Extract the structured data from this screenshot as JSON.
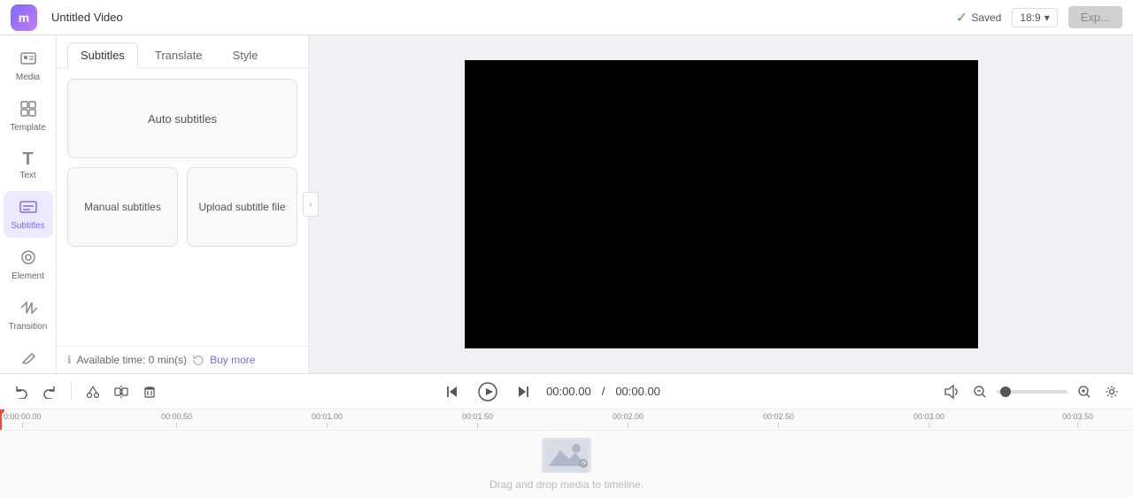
{
  "app": {
    "logo": "m",
    "title": "Untitled Video"
  },
  "topbar": {
    "saved_label": "Saved",
    "aspect_ratio": "18:9",
    "export_label": "Exp..."
  },
  "nav": {
    "items": [
      {
        "id": "media",
        "label": "Media",
        "icon": "⊞"
      },
      {
        "id": "template",
        "label": "Template",
        "icon": "⊡"
      },
      {
        "id": "text",
        "label": "Text",
        "icon": "T"
      },
      {
        "id": "subtitles",
        "label": "Subtitles",
        "icon": "▤",
        "active": true
      },
      {
        "id": "element",
        "label": "Element",
        "icon": "◎"
      },
      {
        "id": "transition",
        "label": "Transition",
        "icon": "⋙"
      }
    ]
  },
  "panel": {
    "tabs": [
      {
        "id": "subtitles",
        "label": "Subtitles",
        "active": true
      },
      {
        "id": "translate",
        "label": "Translate",
        "active": false
      },
      {
        "id": "style",
        "label": "Style",
        "active": false
      }
    ],
    "cards": {
      "auto": "Auto subtitles",
      "manual": "Manual subtitles",
      "upload": "Upload subtitle file"
    },
    "footer": {
      "icon": "ℹ",
      "text": "Available time: 0 min(s)",
      "link_label": "Buy more"
    }
  },
  "timeline": {
    "toolbar": {
      "undo_label": "↩",
      "redo_label": "↪",
      "cut_label": "✂",
      "split_label": "⊕",
      "delete_label": "🗑"
    },
    "transport": {
      "skip_back": "⏮",
      "play": "▶",
      "skip_fwd": "⏭",
      "time_current": "00:00.00",
      "time_sep": "/",
      "time_total": "00:00.00"
    },
    "right_controls": {
      "volume_icon": "🔊",
      "zoom_out": "−",
      "zoom_in": "+",
      "settings": "⚙"
    },
    "ruler_marks": [
      "0:00:00.00",
      "00:00.50",
      "00:01.00",
      "00:01.50",
      "00:02.00",
      "00:02.50",
      "00:03.00",
      "00:03.50"
    ],
    "empty_hint": "Drag and drop media to timeline."
  }
}
